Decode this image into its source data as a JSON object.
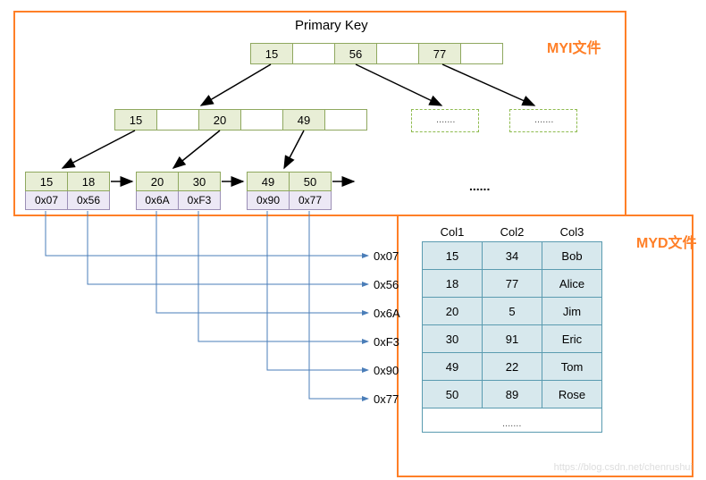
{
  "diagram": {
    "title": "Primary Key",
    "myi_label": "MYI文件",
    "myd_label": "MYD文件",
    "root": [
      "15",
      "56",
      "77"
    ],
    "mid": [
      "15",
      "20",
      "49"
    ],
    "leaves": [
      {
        "keys": [
          "15",
          "18"
        ],
        "addrs": [
          "0x07",
          "0x56"
        ]
      },
      {
        "keys": [
          "20",
          "30"
        ],
        "addrs": [
          "0x6A",
          "0xF3"
        ]
      },
      {
        "keys": [
          "49",
          "50"
        ],
        "addrs": [
          "0x90",
          "0x77"
        ]
      }
    ],
    "dots": "......",
    "headers": [
      "Col1",
      "Col2",
      "Col3"
    ],
    "rows": [
      {
        "addr": "0x07",
        "c1": "15",
        "c2": "34",
        "c3": "Bob"
      },
      {
        "addr": "0x56",
        "c1": "18",
        "c2": "77",
        "c3": "Alice"
      },
      {
        "addr": "0x6A",
        "c1": "20",
        "c2": "5",
        "c3": "Jim"
      },
      {
        "addr": "0xF3",
        "c1": "30",
        "c2": "91",
        "c3": "Eric"
      },
      {
        "addr": "0x90",
        "c1": "49",
        "c2": "22",
        "c3": "Tom"
      },
      {
        "addr": "0x77",
        "c1": "50",
        "c2": "89",
        "c3": "Rose"
      }
    ],
    "cont": ".......",
    "watermark": "https://blog.csdn.net/chenrushui"
  }
}
